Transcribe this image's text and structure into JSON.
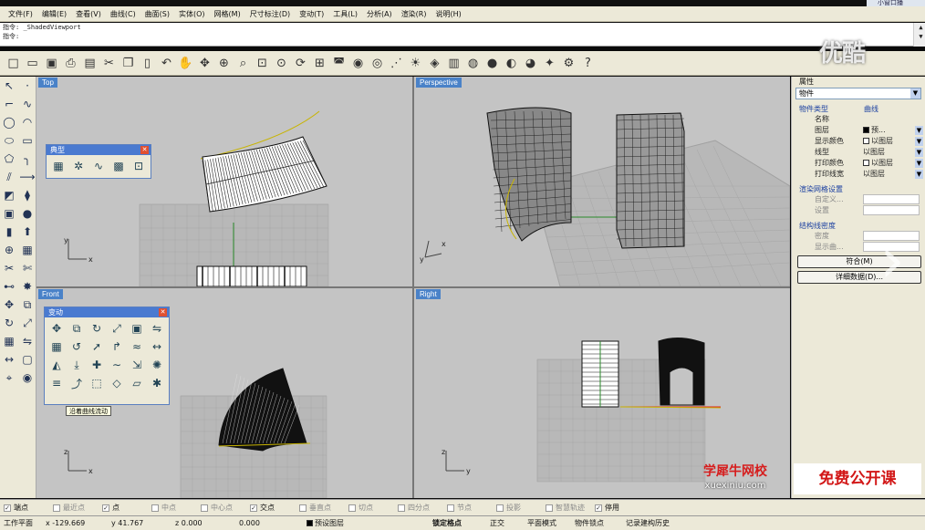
{
  "tab_fragment": "小窗口播",
  "menu": [
    "文件(F)",
    "编辑(E)",
    "查看(V)",
    "曲线(C)",
    "曲面(S)",
    "实体(O)",
    "网格(M)",
    "尺寸标注(D)",
    "变动(T)",
    "工具(L)",
    "分析(A)",
    "渲染(R)",
    "说明(H)"
  ],
  "command": {
    "history_label": "指令",
    "history_value": "_ShadedViewport",
    "prompt_label": "指令:"
  },
  "toolbar_icons": [
    "new-icon",
    "open-icon",
    "save-icon",
    "print-icon",
    "import-icon",
    "cut-icon",
    "copy-icon",
    "paste-icon",
    "undo-icon",
    "pan-icon",
    "move-view-icon",
    "zoom-icon",
    "zoom-window-icon",
    "zoom-extents-icon",
    "zoom-selected-icon",
    "rotate-view-icon",
    "four-views-icon",
    "car-icon",
    "render-icon",
    "point-snap-icon",
    "grid-snap-icon",
    "light-icon",
    "material-icon",
    "layer-icon",
    "color-wheel-icon",
    "sphere-icon",
    "shade-icon",
    "render-sphere-icon",
    "tools-icon",
    "options-icon",
    "help-icon"
  ],
  "viewports": {
    "top": "Top",
    "perspective": "Perspective",
    "front": "Front",
    "right": "Right"
  },
  "axes": {
    "x": "x",
    "y": "y",
    "z": "z"
  },
  "panel_typical": {
    "title": "典型",
    "icons": [
      "grid-icon",
      "snap-gear-icon",
      "curve-points-icon",
      "solid-box-icon",
      "zoom-target-icon"
    ]
  },
  "panel_transform": {
    "title": "变动",
    "icons": [
      "move-icon",
      "copy-tool-icon",
      "rotate-icon",
      "scale-icon",
      "box-icon",
      "mirror-icon",
      "array-icon",
      "twist-icon",
      "orient-icon",
      "bend-icon",
      "flow-icon",
      "stretch-icon",
      "taper-icon",
      "project-icon",
      "splop-icon",
      "smooth-icon",
      "drag-icon",
      "array-polar-icon",
      "align-icon",
      "flow-along-curve-icon",
      "cage-icon",
      "morph-icon",
      "shear-icon",
      "sporph-icon"
    ]
  },
  "tooltip": "沿着曲线流动",
  "properties": {
    "title": "属性",
    "dropdown": "物件",
    "object_type_label": "物件类型",
    "object_type_value": "曲线",
    "rows": [
      {
        "key": "名称",
        "value": "",
        "color": ""
      },
      {
        "key": "图层",
        "value": "预...",
        "color": "#000000"
      },
      {
        "key": "显示颜色",
        "value": "以图层",
        "color": "#ffffff"
      },
      {
        "key": "线型",
        "value": "以图层",
        "color": ""
      },
      {
        "key": "打印颜色",
        "value": "以图层",
        "color": "#ffffff"
      },
      {
        "key": "打印线宽",
        "value": "以图层",
        "color": ""
      }
    ],
    "render_mesh_label": "渲染网格设置",
    "render_rows": [
      {
        "key": "自定义...",
        "value": ""
      },
      {
        "key": "设置",
        "value": ""
      }
    ],
    "struct_label": "结构线密度",
    "struct_rows": [
      {
        "key": "密度",
        "value": ""
      },
      {
        "key": "显示曲...",
        "value": ""
      }
    ],
    "match_button": "符合(M)",
    "details_button": "详细数据(D)..."
  },
  "watermarks": {
    "youku": "优酷",
    "xuexiniu_cn": "学犀牛网校",
    "xuexiniu_url": "xuexiniu.com",
    "free_course": "免费公开课"
  },
  "osnaps": [
    {
      "label": "端点",
      "on": true
    },
    {
      "label": "最近点",
      "on": false
    },
    {
      "label": "点",
      "on": true
    },
    {
      "label": "中点",
      "on": false
    },
    {
      "label": "中心点",
      "on": false
    },
    {
      "label": "交点",
      "on": true
    },
    {
      "label": "垂直点",
      "on": false
    },
    {
      "label": "切点",
      "on": false
    },
    {
      "label": "四分点",
      "on": false
    },
    {
      "label": "节点",
      "on": false
    },
    {
      "label": "投影",
      "on": false
    },
    {
      "label": "智慧轨迹",
      "on": false
    },
    {
      "label": "停用",
      "on": true
    }
  ],
  "status": {
    "cplane": "工作平面",
    "x": "x -129.669",
    "y": "y 41.767",
    "z": "z 0.000",
    "d": "0.000",
    "layer_color": "#000000",
    "layer": "预设图层",
    "lock_grid": "锁定格点",
    "ortho": "正交",
    "planar": "平面模式",
    "object_snap": "物件锁点",
    "record_history": "记录建构历史"
  }
}
